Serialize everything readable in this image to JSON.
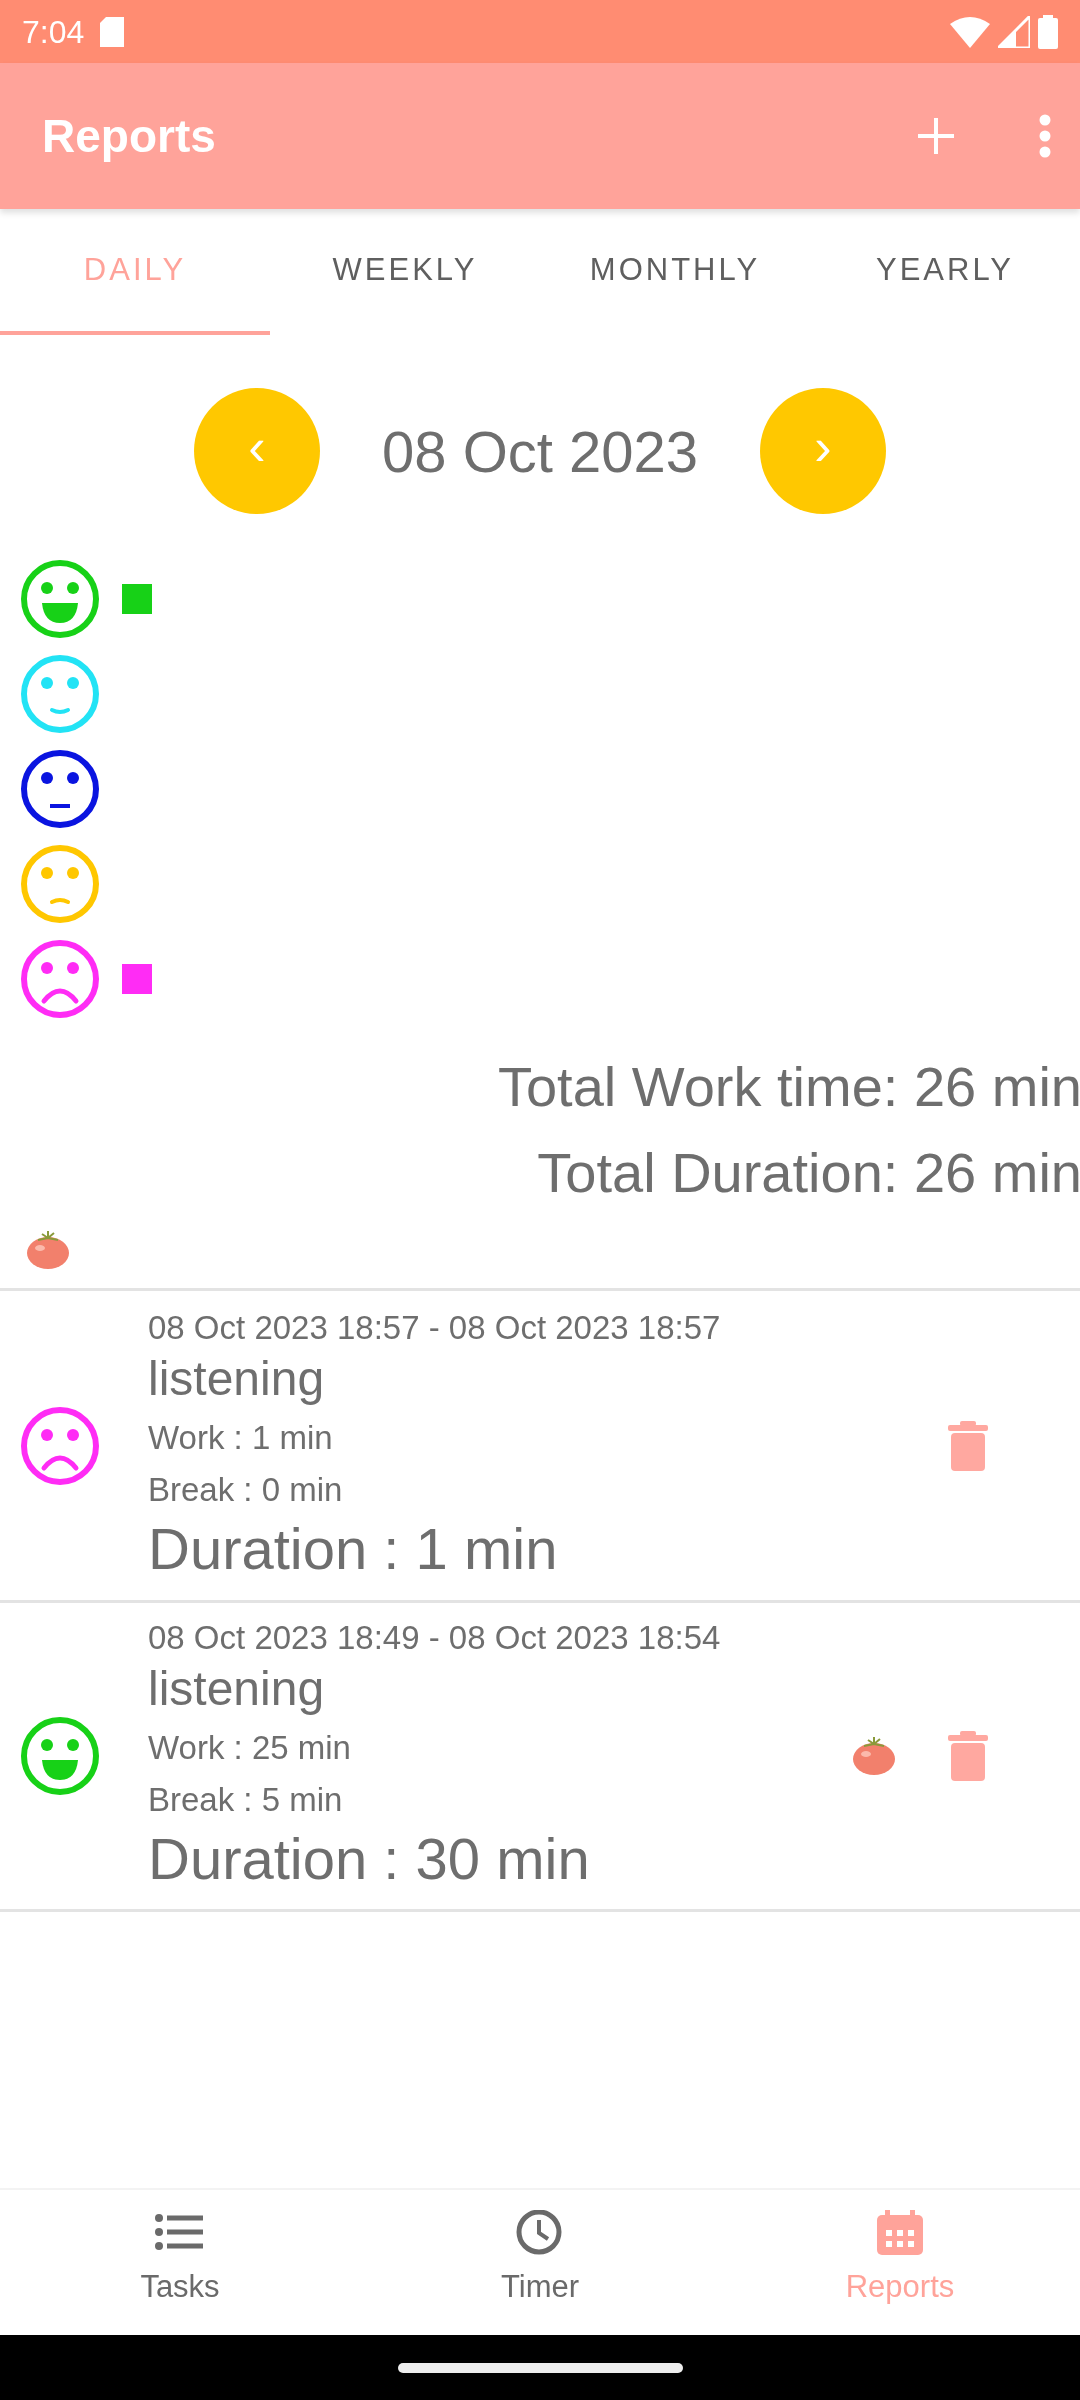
{
  "status_bar": {
    "time": "7:04"
  },
  "app_bar": {
    "title": "Reports"
  },
  "tabs": [
    {
      "label": "DAILY",
      "selected": true
    },
    {
      "label": "WEEKLY",
      "selected": false
    },
    {
      "label": "MONTHLY",
      "selected": false
    },
    {
      "label": "YEARLY",
      "selected": false
    }
  ],
  "date_nav": {
    "prev": "‹",
    "date": "08 Oct 2023",
    "next": "›"
  },
  "moods": [
    {
      "kind": "grin",
      "color": "#17d117",
      "marked": true
    },
    {
      "kind": "smile",
      "color": "#22e3f5",
      "marked": false
    },
    {
      "kind": "neutral",
      "color": "#0a14e0",
      "marked": false
    },
    {
      "kind": "meh",
      "color": "#ffc700",
      "marked": false
    },
    {
      "kind": "sad",
      "color": "#ff2cf5",
      "marked": true
    }
  ],
  "totals": [
    "Total Work time: 26 min",
    "Total Duration: 26 min"
  ],
  "entries": [
    {
      "kind": "sad",
      "color": "#ff2cf5",
      "time_range": "08 Oct 2023 18:57 - 08 Oct 2023 18:57",
      "title": "listening",
      "work": "Work  : 1 min",
      "break": "Break : 0 min",
      "duration": "Duration : 1 min",
      "tomato": false
    },
    {
      "kind": "grin",
      "color": "#17d117",
      "time_range": "08 Oct 2023 18:49 - 08 Oct 2023 18:54",
      "title": "listening",
      "work": "Work  : 25 min",
      "break": "Break : 5 min",
      "duration": "Duration : 30 min",
      "tomato": true
    }
  ],
  "bottom_nav": [
    {
      "kind": "list",
      "label": "Tasks",
      "selected": false
    },
    {
      "kind": "clock",
      "label": "Timer",
      "selected": false
    },
    {
      "kind": "calendar",
      "label": "Reports",
      "selected": true
    }
  ]
}
